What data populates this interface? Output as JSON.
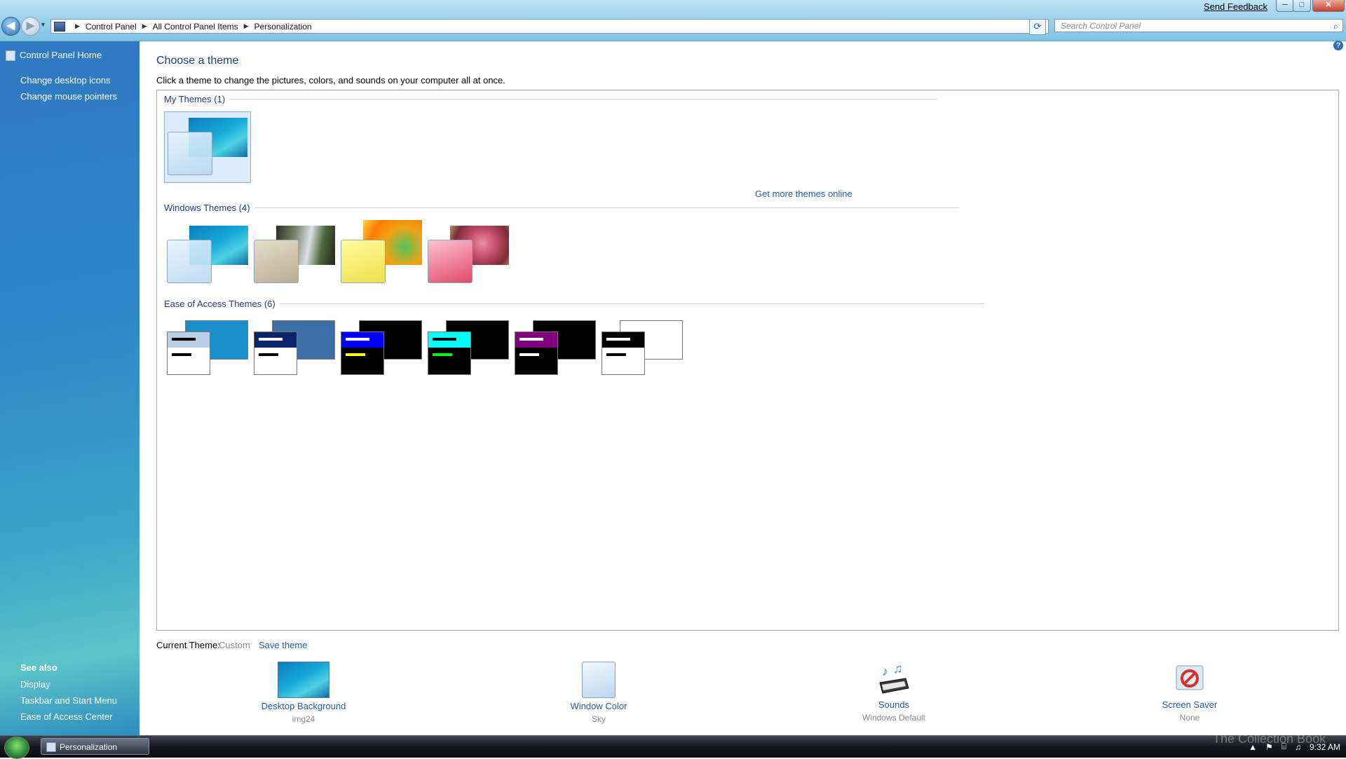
{
  "window": {
    "send_feedback": "Send Feedback",
    "minimize": "─",
    "maximize": "□",
    "close": "✕"
  },
  "address_bar": {
    "back_glyph": "◀",
    "forward_glyph": "▶",
    "breadcrumbs": [
      "Control Panel",
      "All Control Panel Items",
      "Personalization"
    ],
    "search_placeholder": "Search Control Panel",
    "refresh_glyph": "⟳",
    "search_glyph": "⌕"
  },
  "left_pane": {
    "home": "Control Panel Home",
    "tasks": [
      "Change desktop icons",
      "Change mouse pointers"
    ],
    "see_also_title": "See also",
    "see_also": [
      "Display",
      "Taskbar and Start Menu",
      "Ease of Access Center"
    ]
  },
  "main": {
    "title": "Choose a theme",
    "description": "Click a theme to change the pictures, colors, and sounds on your computer all at once.",
    "groups": {
      "my_themes": "My Themes (1)",
      "windows_themes": "Windows Themes (4)",
      "ease_of_access": "Ease of Access Themes (6)"
    },
    "get_more": "Get more themes online",
    "help_glyph": "?"
  },
  "themes": {
    "my": [
      {
        "name": "Custom",
        "style": "aero",
        "selected": true
      }
    ],
    "windows": [
      {
        "style": "aero"
      },
      {
        "style": "architecture"
      },
      {
        "style": "characters"
      },
      {
        "style": "landscapes"
      }
    ],
    "ease_of_access": [
      {
        "style": "basic",
        "bg": "#1a8ec8",
        "fg": "#ffffff",
        "bar": "#b9cfe6",
        "l1": "#000000",
        "l2": "#000000"
      },
      {
        "style": "contrast-1",
        "bg": "#3a6ea5",
        "fg": "#ffffff",
        "bar": "#0a246a",
        "l1": "#ffffff",
        "l2": "#000000"
      },
      {
        "style": "contrast-2",
        "bg": "#000000",
        "fg": "#000000",
        "bar": "#0000ff",
        "l1": "#ffffff",
        "l2": "#ffff00"
      },
      {
        "style": "contrast-black",
        "bg": "#000000",
        "fg": "#000000",
        "bar": "#00ffff",
        "l1": "#000000",
        "l2": "#00ff00"
      },
      {
        "style": "contrast-purple",
        "bg": "#000000",
        "fg": "#000000",
        "bar": "#800080",
        "l1": "#ffffff",
        "l2": "#ffffff"
      },
      {
        "style": "contrast-white",
        "bg": "#ffffff",
        "fg": "#ffffff",
        "bar": "#000000",
        "l1": "#ffffff",
        "l2": "#000000"
      }
    ]
  },
  "bottom": {
    "current_label": "Current Theme:",
    "current_value": "Custom",
    "save_theme": "Save theme",
    "items": [
      {
        "label": "Desktop Background",
        "value": "img24"
      },
      {
        "label": "Window Color",
        "value": "Sky"
      },
      {
        "label": "Sounds",
        "value": "Windows Default"
      },
      {
        "label": "Screen Saver",
        "value": "None"
      }
    ]
  },
  "taskbar": {
    "window_button": "Personalization",
    "time": "9:32 AM",
    "watermark": "The Collection Book"
  },
  "colors": {
    "link": "#1e5fb0",
    "heading": "#1e3c8c",
    "left_pane_top": "#2f79c2"
  }
}
